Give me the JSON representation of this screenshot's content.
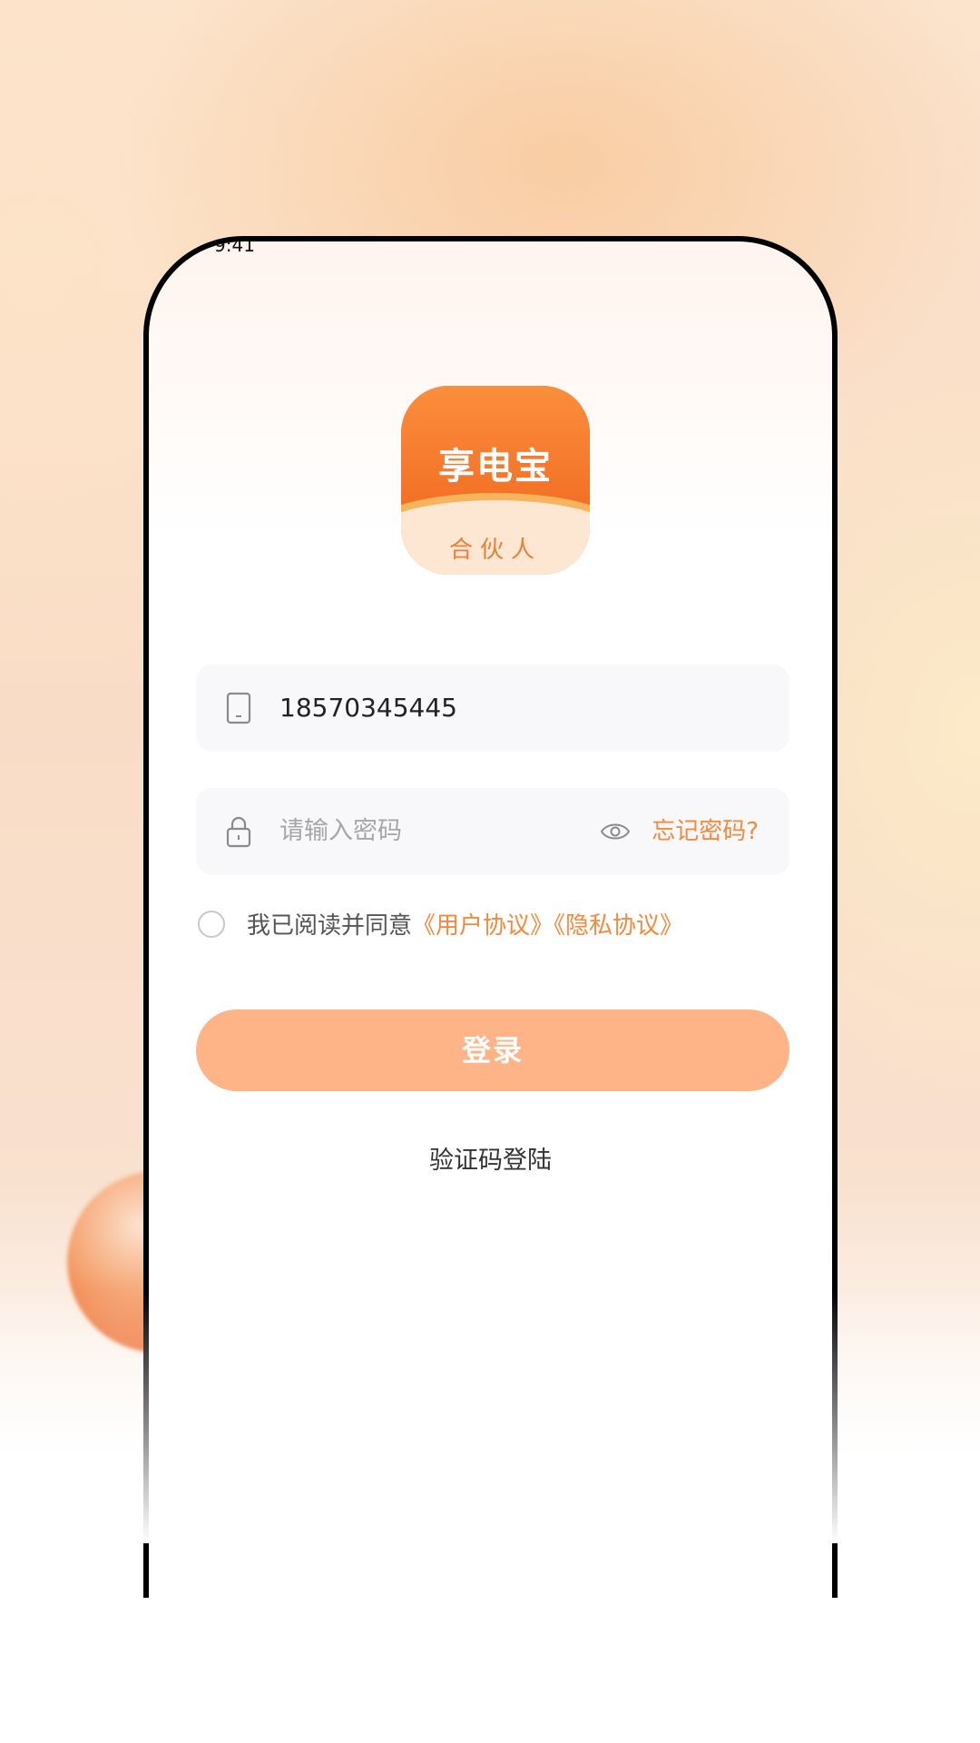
{
  "status_bar": {
    "text": "9:41"
  },
  "logo": {
    "title": "享电宝",
    "subtitle": "合伙人"
  },
  "phone_field": {
    "value": "18570345445"
  },
  "password_field": {
    "placeholder": "请输入密码",
    "forgot_label": "忘记密码?"
  },
  "agreement": {
    "prefix": "我已阅读并同意",
    "user_agreement": "《用户协议》",
    "privacy_policy": "《隐私协议》",
    "checked": false
  },
  "login_button": {
    "label": "登录"
  },
  "sms_login": {
    "label": "验证码登陆"
  },
  "colors": {
    "accent": "#f5893d",
    "button": "#ffb487"
  }
}
